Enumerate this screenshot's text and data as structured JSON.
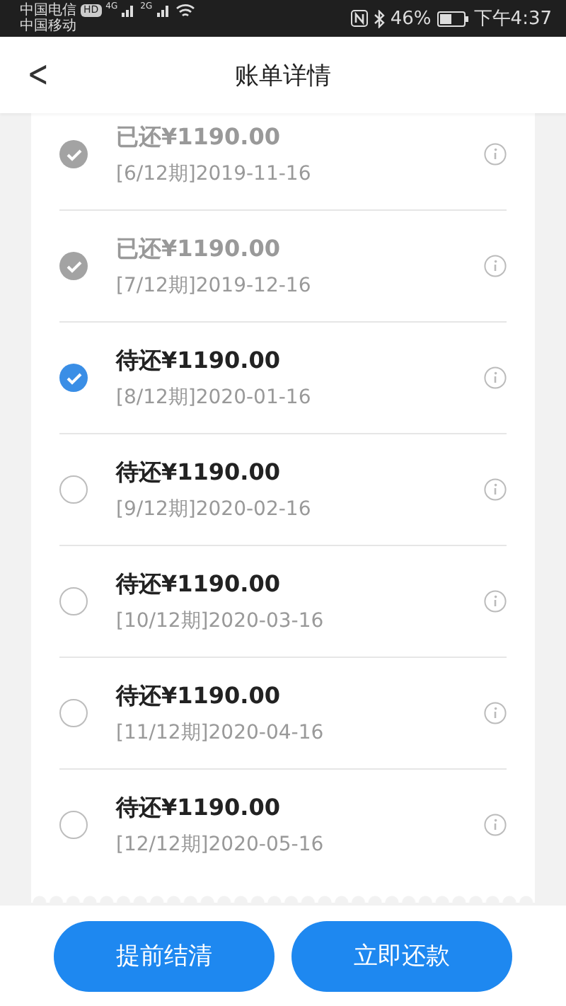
{
  "status_bar": {
    "carrier_1": "中国电信",
    "hd_badge": "HD",
    "network_1": "4G",
    "carrier_2": "中国移动",
    "network_2": "2G",
    "battery": "46%",
    "time": "下午4:37"
  },
  "header": {
    "back": "<",
    "title": "账单详情"
  },
  "installments": [
    {
      "kind": "paid",
      "amount": "已还¥1190.00",
      "period": "[6/12期]2019-11-16"
    },
    {
      "kind": "paid",
      "amount": "已还¥1190.00",
      "period": "[7/12期]2019-12-16"
    },
    {
      "kind": "pending",
      "selected": true,
      "amount": "待还¥1190.00",
      "period": "[8/12期]2020-01-16"
    },
    {
      "kind": "pending",
      "selected": false,
      "amount": "待还¥1190.00",
      "period": "[9/12期]2020-02-16"
    },
    {
      "kind": "pending",
      "selected": false,
      "amount": "待还¥1190.00",
      "period": "[10/12期]2020-03-16"
    },
    {
      "kind": "pending",
      "selected": false,
      "amount": "待还¥1190.00",
      "period": "[11/12期]2020-04-16"
    },
    {
      "kind": "pending",
      "selected": false,
      "amount": "待还¥1190.00",
      "period": "[12/12期]2020-05-16"
    }
  ],
  "buttons": [
    "提前结清",
    "立即还款"
  ]
}
